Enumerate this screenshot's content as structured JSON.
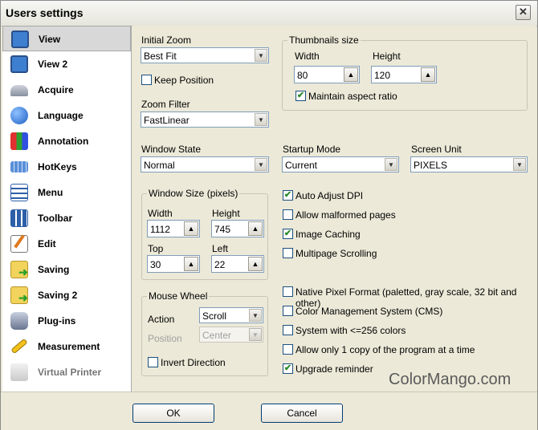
{
  "window": {
    "title": "Users settings"
  },
  "sidebar": {
    "items": [
      {
        "label": "View",
        "icon": "monitor-icon",
        "selected": true
      },
      {
        "label": "View 2",
        "icon": "monitor-icon"
      },
      {
        "label": "Acquire",
        "icon": "scanner-icon"
      },
      {
        "label": "Language",
        "icon": "globe-icon"
      },
      {
        "label": "Annotation",
        "icon": "paint-icon"
      },
      {
        "label": "HotKeys",
        "icon": "keyboard-icon"
      },
      {
        "label": "Menu",
        "icon": "menu-icon"
      },
      {
        "label": "Toolbar",
        "icon": "toolbar-icon"
      },
      {
        "label": "Edit",
        "icon": "edit-icon"
      },
      {
        "label": "Saving",
        "icon": "save-folder-icon"
      },
      {
        "label": "Saving 2",
        "icon": "save-folder-icon"
      },
      {
        "label": "Plug-ins",
        "icon": "plugin-icon"
      },
      {
        "label": "Measurement",
        "icon": "ruler-icon"
      },
      {
        "label": "Virtual Printer",
        "icon": "printer-icon"
      }
    ]
  },
  "view": {
    "initial_zoom": {
      "label": "Initial Zoom",
      "value": "Best Fit"
    },
    "keep_position": {
      "label": "Keep Position",
      "checked": false
    },
    "zoom_filter": {
      "label": "Zoom Filter",
      "value": "FastLinear"
    },
    "thumbnails": {
      "title": "Thumbnails size",
      "width_label": "Width",
      "width": "80",
      "height_label": "Height",
      "height": "120",
      "maintain_aspect": {
        "label": "Maintain aspect ratio",
        "checked": true
      }
    },
    "window_state": {
      "label": "Window State",
      "value": "Normal"
    },
    "startup_mode": {
      "label": "Startup Mode",
      "value": "Current"
    },
    "screen_unit": {
      "label": "Screen Unit",
      "value": "PIXELS"
    },
    "window_size": {
      "title": "Window Size (pixels)",
      "width_label": "Width",
      "width": "1112",
      "height_label": "Height",
      "height": "745",
      "top_label": "Top",
      "top": "30",
      "left_label": "Left",
      "left": "22"
    },
    "mouse_wheel": {
      "title": "Mouse Wheel",
      "action_label": "Action",
      "action": "Scroll",
      "position_label": "Position",
      "position": "Center",
      "invert": {
        "label": "Invert Direction",
        "checked": false
      }
    },
    "options": [
      {
        "label": "Auto Adjust DPI",
        "checked": true
      },
      {
        "label": "Allow malformed pages",
        "checked": false
      },
      {
        "label": "Image Caching",
        "checked": true
      },
      {
        "label": "Multipage Scrolling",
        "checked": false
      }
    ],
    "options2": [
      {
        "label": "Native Pixel Format (paletted, gray scale, 32 bit and other)",
        "checked": false
      },
      {
        "label": "Color Management System (CMS)",
        "checked": false
      },
      {
        "label": "System with <=256 colors",
        "checked": false
      },
      {
        "label": "Allow only 1 copy of the program at a time",
        "checked": false
      },
      {
        "label": "Upgrade reminder",
        "checked": true
      }
    ]
  },
  "footer": {
    "ok": "OK",
    "cancel": "Cancel"
  },
  "watermark": "ColorMango.com",
  "colors": {
    "selection": "#d8d8d8",
    "dialog_bg": "#ece9d8",
    "check": "#2a8a2a"
  }
}
